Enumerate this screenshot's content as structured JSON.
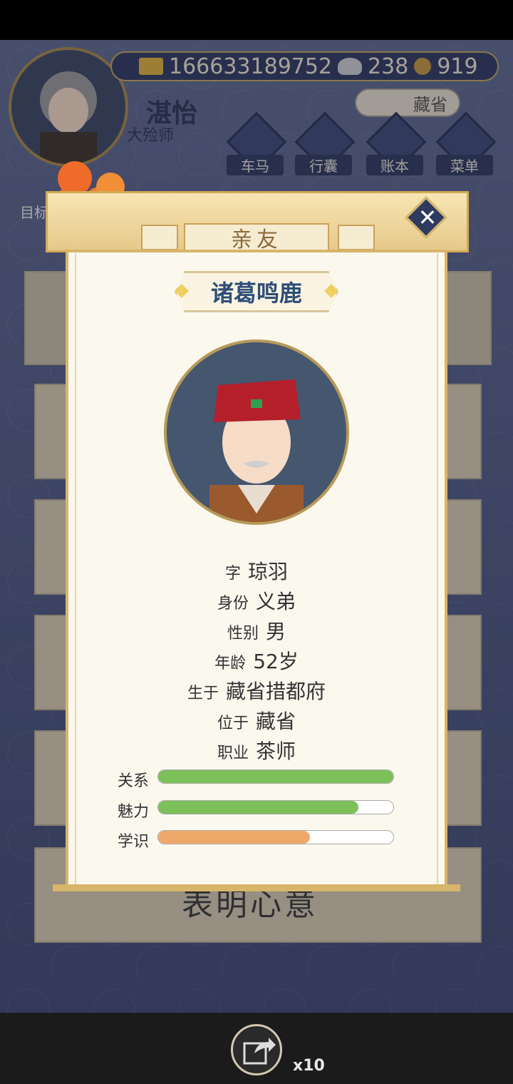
{
  "resources": {
    "gold": "166633189752",
    "silver": "238",
    "coins": "919"
  },
  "player": {
    "name": "湛怡",
    "title": "大殓师",
    "location_button": "藏省"
  },
  "nav": [
    "车马",
    "行囊",
    "账本",
    "菜单"
  ],
  "goal_label": "目标",
  "modal": {
    "header": "亲友",
    "name": "诸葛鸣鹿",
    "info": [
      {
        "key": "字",
        "value": "琼羽"
      },
      {
        "key": "身份",
        "value": "义弟"
      },
      {
        "key": "性别",
        "value": "男"
      },
      {
        "key": "年龄",
        "value": "52岁"
      },
      {
        "key": "生于",
        "value": "藏省措都府"
      },
      {
        "key": "位于",
        "value": "藏省"
      },
      {
        "key": "职业",
        "value": "茶师"
      }
    ],
    "stats": [
      {
        "label": "关系",
        "value": 1.0,
        "color": "#7cc05a"
      },
      {
        "label": "魅力",
        "value": 0.85,
        "color": "#7cc05a"
      },
      {
        "label": "学识",
        "value": 0.645,
        "color": "#f0a86a"
      }
    ]
  },
  "background_button": "表明心意",
  "share_count": "x10"
}
